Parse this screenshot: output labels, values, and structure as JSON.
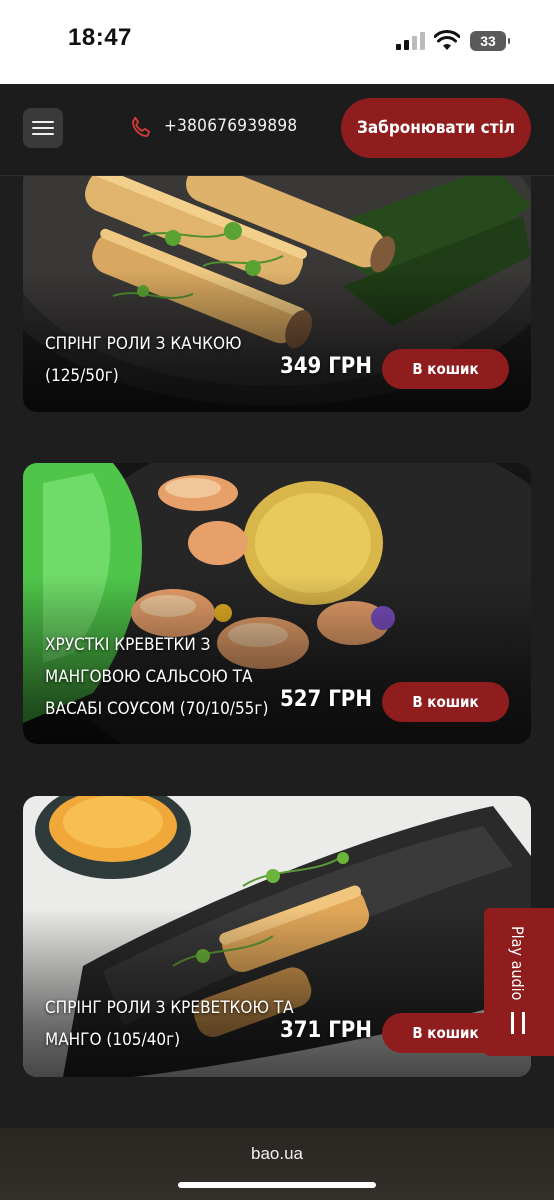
{
  "status_bar": {
    "time": "18:47",
    "battery": "33"
  },
  "header": {
    "phone_number": "+380676939898",
    "book_button": "Забронювати стіл"
  },
  "products": [
    {
      "name": "СПРІНГ РОЛИ З КАЧКОЮ (125/50г)",
      "price": "349 ГРН",
      "cart_button": "В кошик"
    },
    {
      "name": "ХРУСТКІ КРЕВЕТКИ З МАНГОВОЮ САЛЬСОЮ ТА ВАСАБІ СОУСОМ (70/10/55г)",
      "price": "527 ГРН",
      "cart_button": "В кошик"
    },
    {
      "name": "СПРІНГ РОЛИ З КРЕВЕТКОЮ ТА МАНГО (105/40г)",
      "price": "371 ГРН",
      "cart_button": "В кошик"
    }
  ],
  "audio": {
    "label": "Play audio"
  },
  "browser": {
    "url": "bao.ua"
  },
  "colors": {
    "accent": "#8f1d1d",
    "page_background": "#1e1e1e",
    "header_background": "#1c1c1c"
  },
  "icons": [
    "menu-icon",
    "phone-icon",
    "pause-icon",
    "wifi-icon",
    "signal-icon",
    "battery-icon"
  ]
}
